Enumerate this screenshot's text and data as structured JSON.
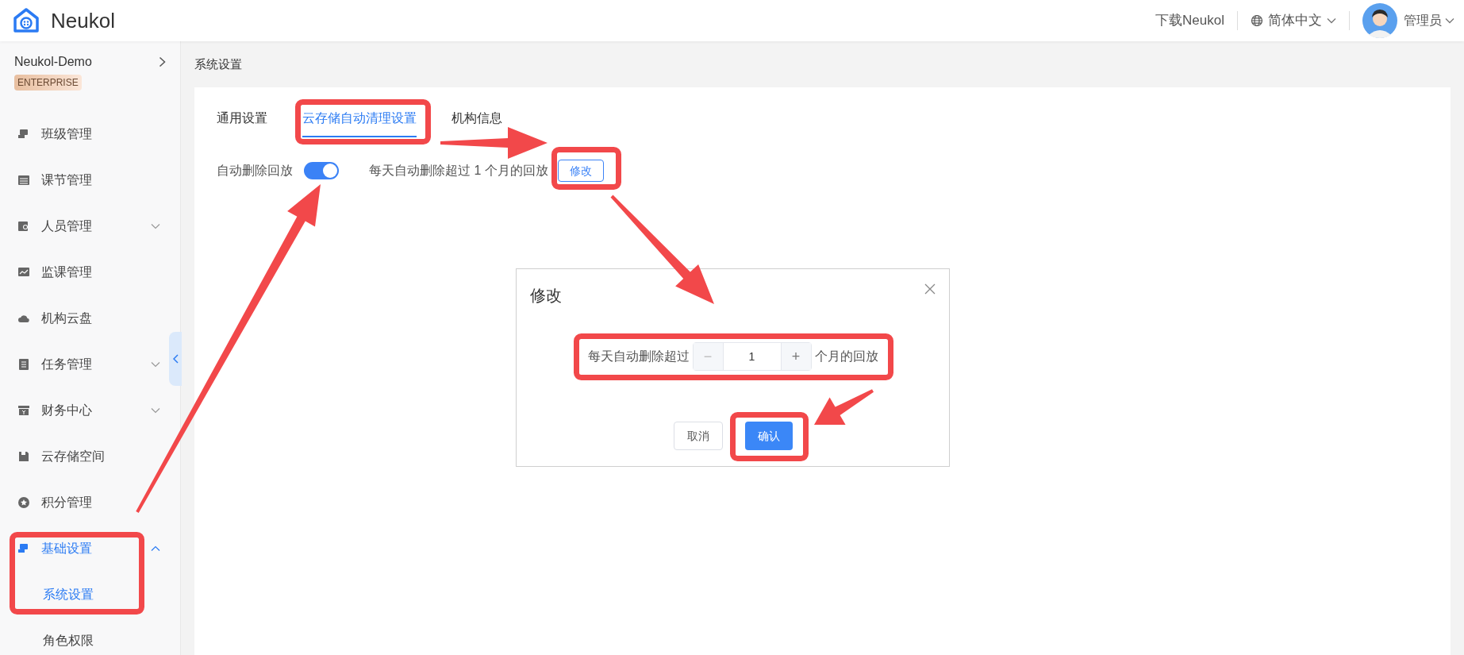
{
  "app": {
    "name": "Neukol"
  },
  "header": {
    "download": "下载Neukol",
    "language": "简体中文",
    "user": "管理员"
  },
  "org": {
    "name": "Neukol-Demo",
    "badge": "ENTERPRISE"
  },
  "sidebar": {
    "items": [
      {
        "label": "班级管理",
        "kind": "link",
        "selected": false
      },
      {
        "label": "课节管理",
        "kind": "link",
        "selected": false
      },
      {
        "label": "人员管理",
        "kind": "group",
        "selected": false,
        "expanded": false
      },
      {
        "label": "监课管理",
        "kind": "link",
        "selected": false
      },
      {
        "label": "机构云盘",
        "kind": "link",
        "selected": false
      },
      {
        "label": "任务管理",
        "kind": "group",
        "selected": false,
        "expanded": false
      },
      {
        "label": "财务中心",
        "kind": "group",
        "selected": false,
        "expanded": false
      },
      {
        "label": "云存储空间",
        "kind": "link",
        "selected": false
      },
      {
        "label": "积分管理",
        "kind": "link",
        "selected": false
      },
      {
        "label": "基础设置",
        "kind": "group",
        "selected": true,
        "expanded": true,
        "children": [
          {
            "label": "系统设置",
            "selected": true
          },
          {
            "label": "角色权限",
            "selected": false
          }
        ]
      }
    ]
  },
  "breadcrumb": "系统设置",
  "tabs": [
    {
      "label": "通用设置",
      "selected": false
    },
    {
      "label": "云存储自动清理设置",
      "selected": true
    },
    {
      "label": "机构信息",
      "selected": false
    }
  ],
  "setting": {
    "label": "自动删除回放",
    "on": true,
    "description": "每天自动删除超过 1 个月的回放",
    "edit_button": "修改"
  },
  "dialog": {
    "title": "修改",
    "prefix": "每天自动删除超过",
    "decrement": "−",
    "value": "1",
    "increment": "+",
    "suffix": "个月的回放",
    "buttons": [
      {
        "label": "取消",
        "kind": "default"
      },
      {
        "label": "确认",
        "kind": "primary"
      }
    ]
  }
}
